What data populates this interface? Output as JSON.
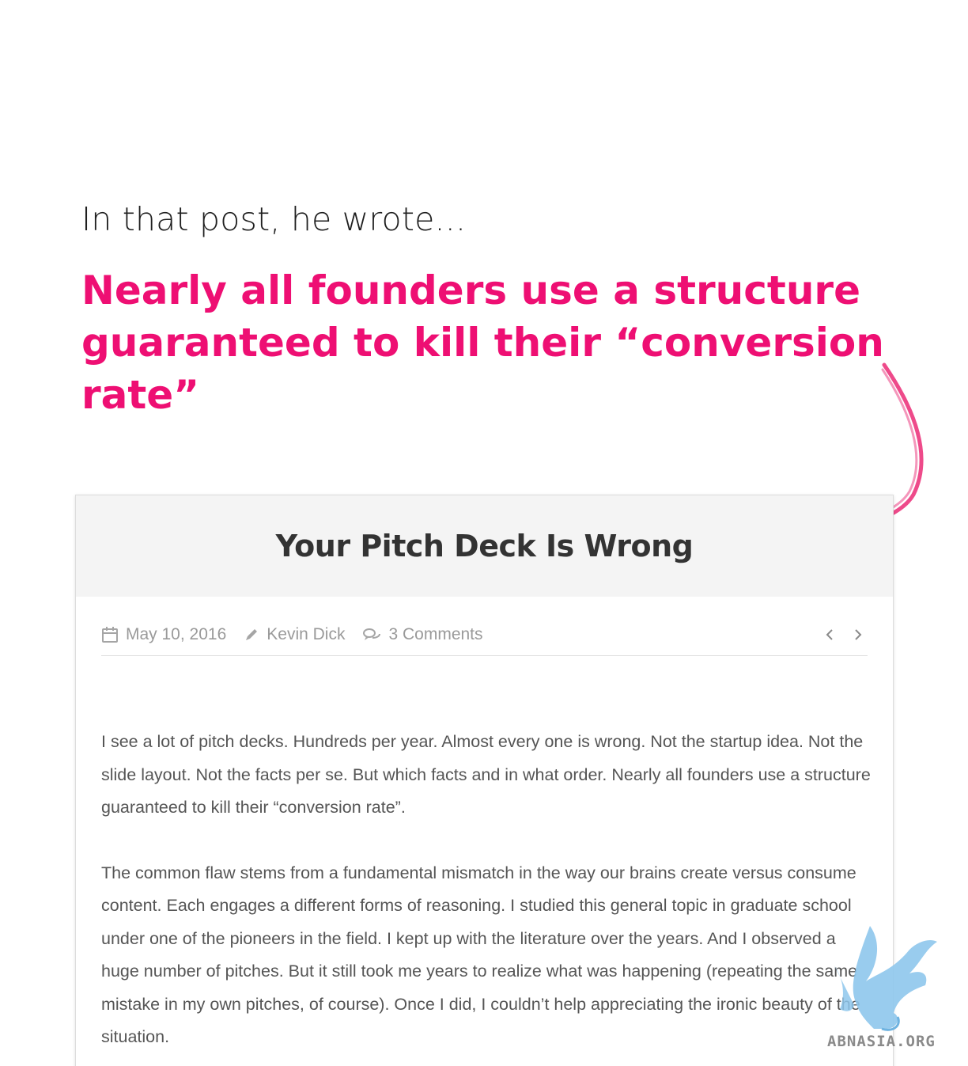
{
  "intro": "In that post, he wrote...",
  "headline": {
    "line1": "Nearly all founders use a structure",
    "line2": "guaranteed to kill their “conversion rate”"
  },
  "colors": {
    "accent": "#ee0f73",
    "header_bg": "#f4f4f4",
    "meta_text": "#9a9a9a",
    "body_text": "#555555"
  },
  "article": {
    "title": "Your Pitch Deck Is Wrong",
    "date": "May 10, 2016",
    "author": "Kevin Dick",
    "comments": "3 Comments",
    "paragraphs": [
      "I see a lot of pitch decks. Hundreds per year. Almost every one is wrong. Not the startup idea. Not the slide layout. Not the facts per se. But which facts and in what order. Nearly all founders use a structure guaranteed to kill their “conversion rate”.",
      "The common flaw stems from a fundamental mismatch in the way our brains create versus consume content. Each engages a different forms of reasoning. I studied this general topic in graduate school under one of the pioneers in the field. I kept up with the literature over the years. And I observed a huge number of pitches. But it still took me years to realize what was happening (repeating the same mistake in my own pitches, of course). Once I did, I couldn’t help appreciating the ironic beauty of the situation."
    ]
  },
  "icons": {
    "date": "calendar-icon",
    "author": "pencil-icon",
    "comments": "comments-icon",
    "prev": "chevron-left-icon",
    "next": "chevron-right-icon",
    "arrow": "hand-drawn-arrow-icon",
    "watermark": "griffin-logo-icon"
  },
  "watermark": {
    "text": "ABNASIA.ORG"
  }
}
